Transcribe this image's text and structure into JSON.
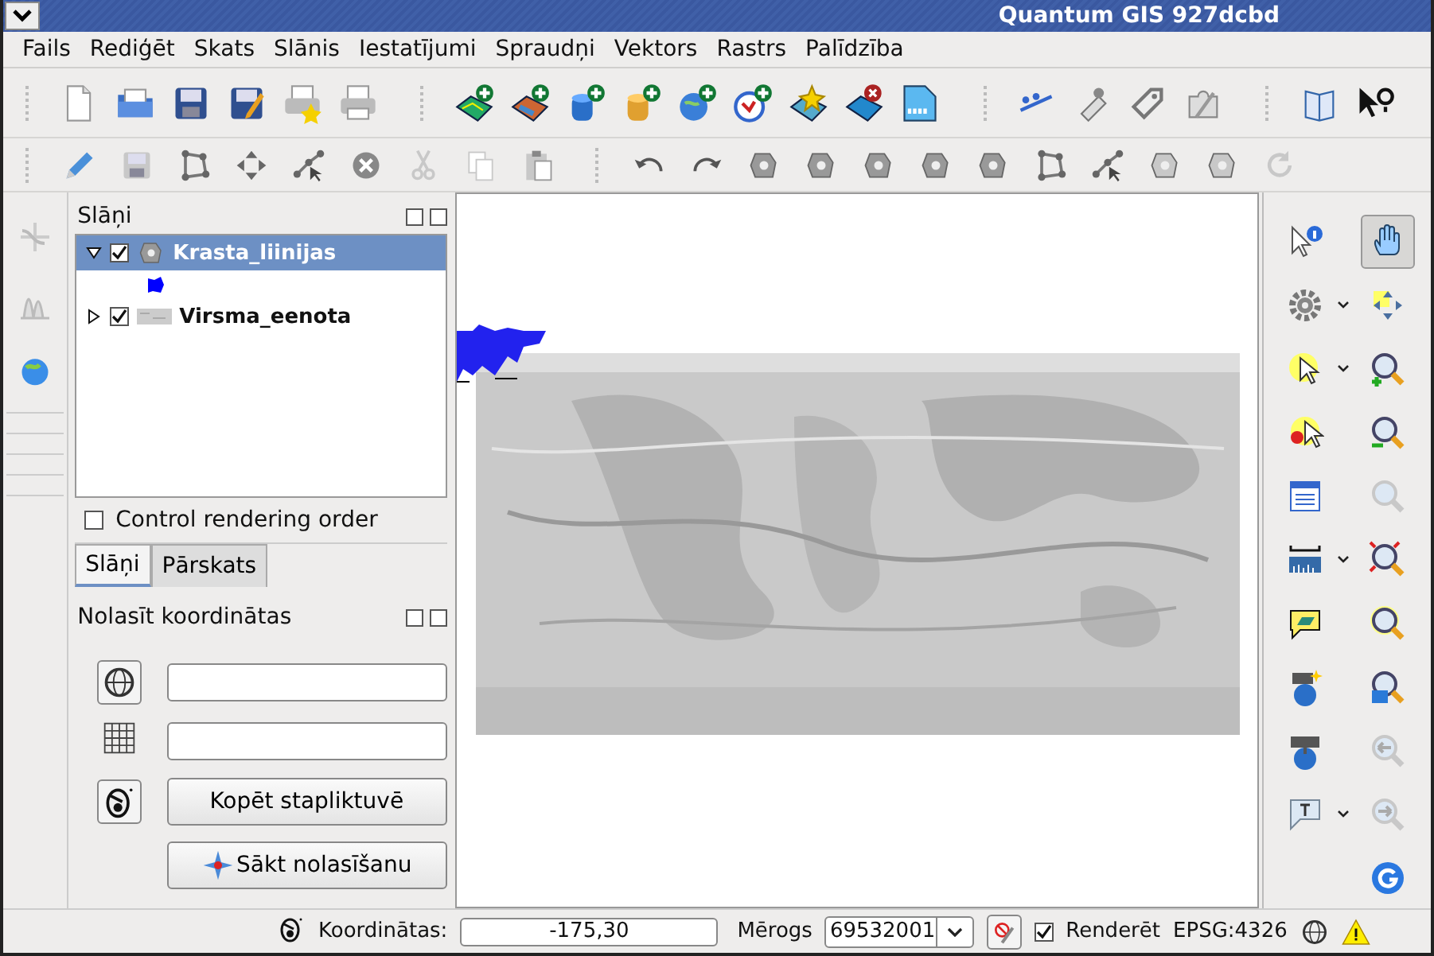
{
  "window": {
    "title": "Quantum GIS 927dcbd"
  },
  "menu": [
    {
      "label": "Fails"
    },
    {
      "label": "Rediģēt"
    },
    {
      "label": "Skats"
    },
    {
      "label": "Slānis"
    },
    {
      "label": "Iestatījumi"
    },
    {
      "label": "Spraudņi"
    },
    {
      "label": "Vektors"
    },
    {
      "label": "Rastrs"
    },
    {
      "label": "Palīdzība"
    }
  ],
  "layers_panel": {
    "title": "Slāņi",
    "layers": [
      {
        "name": "Krasta_liinijas",
        "kind": "vector",
        "checked": true,
        "expanded": true,
        "selected": true,
        "children": [
          {
            "kind": "fill-symbol"
          }
        ]
      },
      {
        "name": "Virsma_eenota",
        "kind": "raster",
        "checked": true,
        "expanded": false,
        "selected": false
      }
    ],
    "control_order": {
      "label": "Control rendering order",
      "checked": false
    },
    "tabs": [
      {
        "label": "Slāņi",
        "selected": true
      },
      {
        "label": "Pārskats",
        "selected": false
      }
    ]
  },
  "coords_panel": {
    "title": "Nolasīt koordinātas",
    "copy_button": "Kopēt stapliktuvē",
    "start_button": "Sākt nolasīšanu"
  },
  "map_tools": [
    {
      "kind": "pan",
      "selected": true
    },
    {
      "kind": "pan-selection",
      "selected": false
    },
    {
      "kind": "zoom-in",
      "selected": false
    },
    {
      "kind": "zoom-out",
      "selected": false
    }
  ],
  "status_bar": {
    "coords_label": "Koordinātas:",
    "coords_value": "-175,30",
    "scale_label": "Mērogs",
    "scale_value": "69532001",
    "render": {
      "label": "Renderēt",
      "checked": true
    },
    "crs": "EPSG:4326"
  }
}
